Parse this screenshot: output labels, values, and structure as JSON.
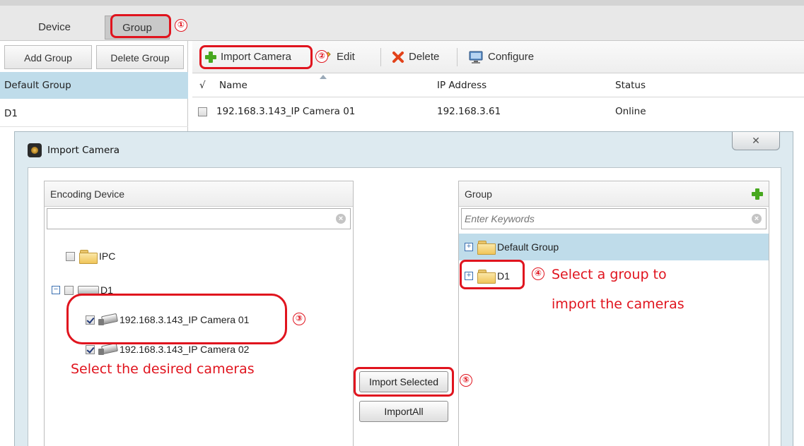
{
  "tabs": [
    {
      "label": "Device"
    },
    {
      "label": "Group"
    }
  ],
  "left_panel": {
    "add_group": "Add Group",
    "delete_group": "Delete Group",
    "groups": [
      "Default Group",
      "D1"
    ]
  },
  "toolbar": {
    "import_camera": "Import Camera",
    "edit": "Edit",
    "delete": "Delete",
    "configure": "Configure"
  },
  "table": {
    "check_header": "√",
    "columns": [
      "Name",
      "IP Address",
      "Status"
    ],
    "rows": [
      {
        "name": "192.168.3.143_IP Camera 01",
        "ip": "192.168.3.61",
        "status": "Online"
      }
    ]
  },
  "dialog": {
    "title": "Import Camera",
    "close_symbol": "✕",
    "encoding": {
      "header": "Encoding Device",
      "search_value": "",
      "items": [
        {
          "label": "IPC",
          "type": "folder",
          "checked": false
        },
        {
          "label": "D1",
          "type": "nvr",
          "checked": false,
          "expanded": true
        },
        {
          "label": "192.168.3.143_IP Camera 01",
          "type": "camera",
          "checked": true
        },
        {
          "label": "192.168.3.143_IP Camera 02",
          "type": "camera",
          "checked": true
        }
      ]
    },
    "group": {
      "header": "Group",
      "search_placeholder": "Enter Keywords",
      "items": [
        {
          "label": "Default Group",
          "selected": true
        },
        {
          "label": "D1",
          "selected": false
        }
      ]
    },
    "import_selected": "Import Selected",
    "import_all": "ImportAll"
  },
  "annotations": {
    "n1": "①",
    "n2": "②",
    "n3": "③",
    "n4": "④",
    "n5": "⑤",
    "select_cameras": "Select the desired cameras",
    "select_group_line1": "Select a group to",
    "select_group_line2": "import the cameras",
    "color": "#e0141e"
  }
}
